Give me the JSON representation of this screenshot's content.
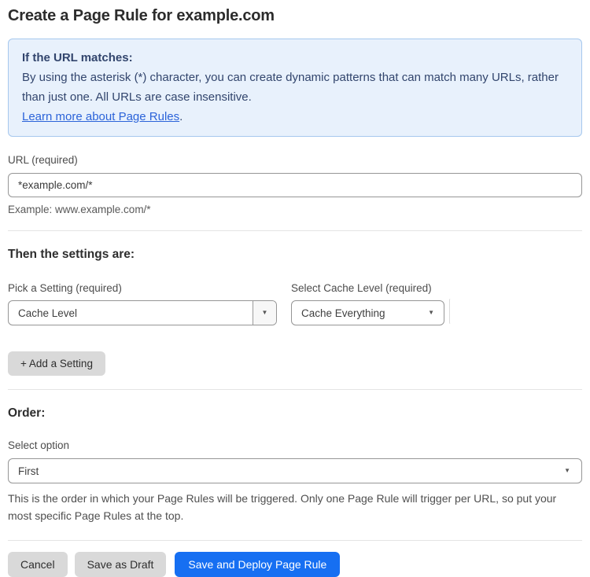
{
  "page": {
    "title": "Create a Page Rule for example.com"
  },
  "info_box": {
    "heading": "If the URL matches:",
    "body": "By using the asterisk (*) character, you can create dynamic patterns that can match many URLs, rather than just one. All URLs are case insensitive.",
    "link_label": "Learn more about Page Rules",
    "link_suffix": "."
  },
  "url_field": {
    "label": "URL (required)",
    "value": "*example.com/*",
    "helper": "Example: www.example.com/*"
  },
  "settings": {
    "heading": "Then the settings are:",
    "setting_select": {
      "label": "Pick a Setting (required)",
      "value": "Cache Level"
    },
    "cache_level_select": {
      "label": "Select Cache Level (required)",
      "value": "Cache Everything"
    },
    "add_setting_label": "+ Add a Setting"
  },
  "order": {
    "heading": "Order:",
    "select_label": "Select option",
    "value": "First",
    "helper": "This is the order in which your Page Rules will be triggered. Only one Page Rule will trigger per URL, so put your most specific Page Rules at the top."
  },
  "actions": {
    "cancel": "Cancel",
    "save_draft": "Save as Draft",
    "save_deploy": "Save and Deploy Page Rule"
  },
  "icons": {
    "dropdown_caret": "▼"
  },
  "colors": {
    "info_bg": "#e8f1fc",
    "info_border": "#a6c8ee",
    "info_text": "#32456d",
    "link_blue": "#2b63d9",
    "primary_blue": "#166ff2",
    "gray_button": "#d9d9d9",
    "input_border": "#969696",
    "divider": "#e4e4e4"
  }
}
